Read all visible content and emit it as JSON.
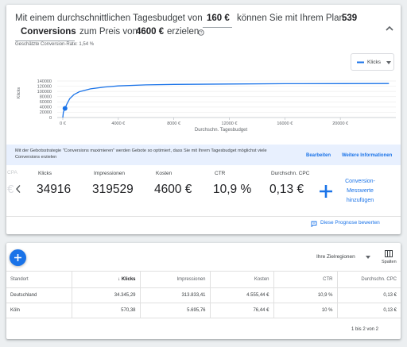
{
  "headline": {
    "prefix": "Mit einem durchschnittlichen Tagesbudget von",
    "budget": "160 €",
    "middle": "können Sie mit Ihrem Plan",
    "conversions_count": "539",
    "conversions_label": "Conversions",
    "price_prefix": "zum Preis von",
    "cost": "4600 €",
    "suffix": "erzielen",
    "help_icon": "help-circle-icon",
    "collapse_icon": "chevron-up-icon"
  },
  "conversion_rate_text": "Geschätzte Conversion-Rate: 1,54 %",
  "metric_selector": {
    "value": "Klicks",
    "icon": "line-legend-icon",
    "arrow_icon": "caret-down-icon"
  },
  "chart_data": {
    "type": "line",
    "ylabel": "Klicks",
    "xlabel": "Durchschn. Tagesbudget",
    "y_ticks": [
      "140000",
      "120000",
      "100000",
      "80000",
      "60000",
      "40000",
      "20000",
      "0"
    ],
    "x_ticks": [
      "0 €",
      "4000 €",
      "8000 €",
      "12000 €",
      "16000 €",
      "20000 €"
    ],
    "ylim": [
      0,
      140000
    ],
    "xlim": [
      -400,
      24000
    ],
    "series": [
      {
        "points": [
          [
            0,
            0
          ],
          [
            40,
            20000
          ],
          [
            100,
            28000
          ],
          [
            160,
            34916
          ],
          [
            300,
            52000
          ],
          [
            500,
            72000
          ],
          [
            800,
            88000
          ],
          [
            1200,
            99000
          ],
          [
            2000,
            110000
          ],
          [
            3000,
            117000
          ],
          [
            4000,
            121000
          ],
          [
            6000,
            125000
          ],
          [
            8000,
            127000
          ],
          [
            12000,
            128500
          ],
          [
            16000,
            129500
          ],
          [
            20000,
            130000
          ],
          [
            23500,
            130200
          ]
        ],
        "marker": {
          "x": 160,
          "y": 34916
        },
        "color": "#1a73e8"
      }
    ]
  },
  "banner": {
    "text": "Mit der Gebotsstrategie \"Conversions maximieren\" werden Gebote so optimiert, dass Sie mit Ihrem Tagesbudget möglichst viele Conversions erzielen",
    "edit_link": "Bearbeiten",
    "more_link": "Weitere Informationen"
  },
  "metrics": {
    "faded_label": "CPA",
    "prev_icon": "chevron-left-icon",
    "items": [
      {
        "label": "Klicks",
        "value": "34916"
      },
      {
        "label": "Impressionen",
        "value": "319529"
      },
      {
        "label": "Kosten",
        "value": "4600 €"
      },
      {
        "label": "CTR",
        "value": "10,9 %"
      },
      {
        "label": "Durchschn. CPC",
        "value": "0,13 €"
      }
    ],
    "add_button": {
      "icon": "plus-icon",
      "label": "Conversion-Messwerte hinzufügen"
    }
  },
  "rate_link": {
    "icon": "feedback-icon",
    "label": "Diese Prognose bewerten"
  },
  "table": {
    "fab_icon": "plus-icon",
    "region_selector": "Ihre Zielregionen",
    "columns_button": {
      "icon": "columns-icon",
      "label": "Spalten"
    },
    "headers": [
      "Standort",
      "Klicks",
      "Impressionen",
      "Kosten",
      "CTR",
      "Durchschn. CPC"
    ],
    "rows": [
      [
        "Deutschland",
        "34.345,29",
        "313.833,41",
        "4.555,44 €",
        "10,9 %",
        "0,13 €"
      ],
      [
        "Köln",
        "570,38",
        "5.695,76",
        "76,44 €",
        "10 %",
        "0,13 €"
      ]
    ],
    "pagination": "1 bis 2 von 2"
  }
}
